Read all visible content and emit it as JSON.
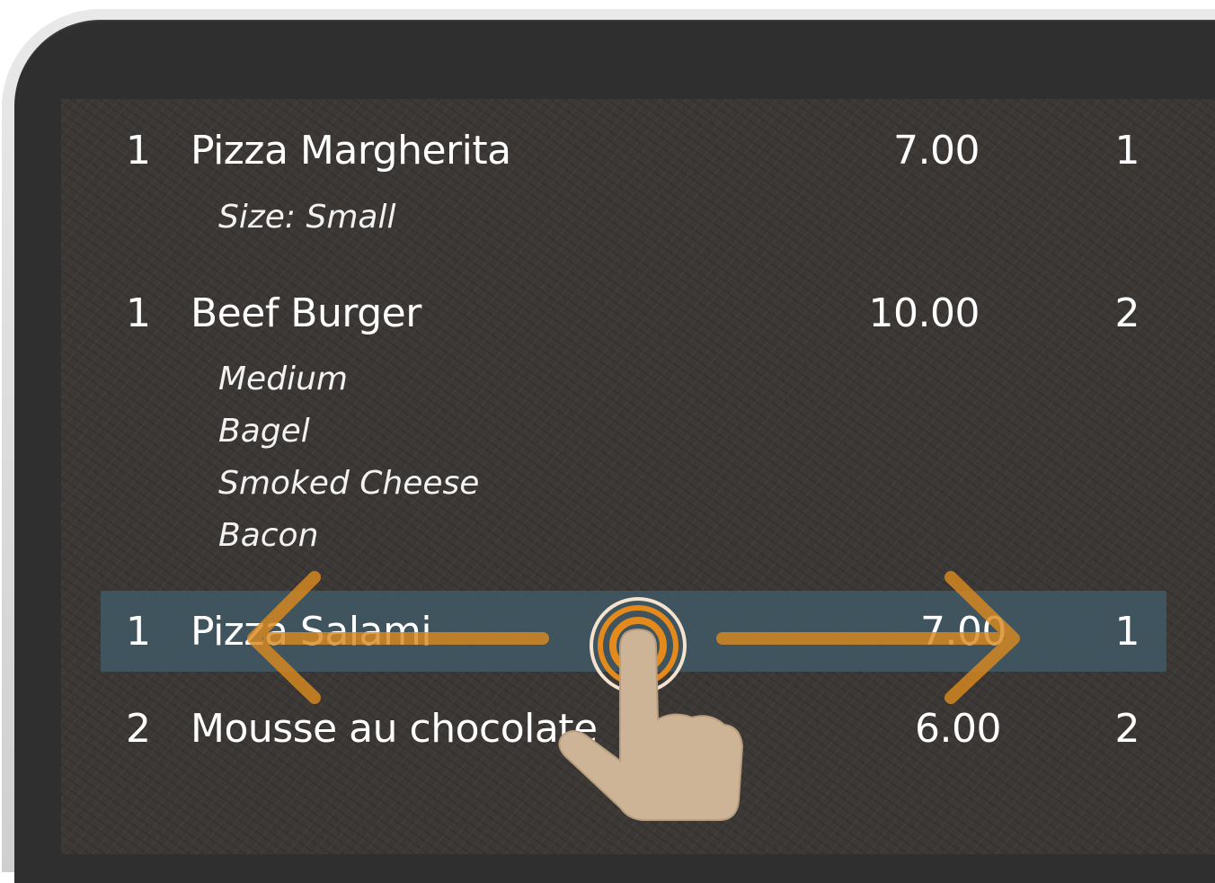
{
  "order": {
    "items": [
      {
        "qty": "1",
        "name": "Pizza Margherita",
        "price": "7.00",
        "seat": "1",
        "modifiers": [
          "Size: Small"
        ]
      },
      {
        "qty": "1",
        "name": "Beef Burger",
        "price": "10.00",
        "seat": "2",
        "modifiers": [
          "Medium",
          "Bagel",
          "Smoked Cheese",
          "Bacon"
        ]
      },
      {
        "qty": "1",
        "name": "Pizza Salami",
        "price": "7.00",
        "seat": "1",
        "modifiers": [],
        "selected": true
      },
      {
        "qty": "2",
        "name": "Mousse au chocolate",
        "price": "6.00",
        "seat": "2",
        "modifiers": []
      }
    ]
  },
  "gesture": {
    "type": "swipe-horizontal",
    "icons": [
      "hand-pointer-icon",
      "arrow-left-icon",
      "arrow-right-icon",
      "touch-ripple-icon"
    ]
  },
  "colors": {
    "screen_bg": "#3b3836",
    "selected_row": "#3f5560",
    "gesture_accent": "#e48a1c",
    "hand": "#cdb496"
  }
}
